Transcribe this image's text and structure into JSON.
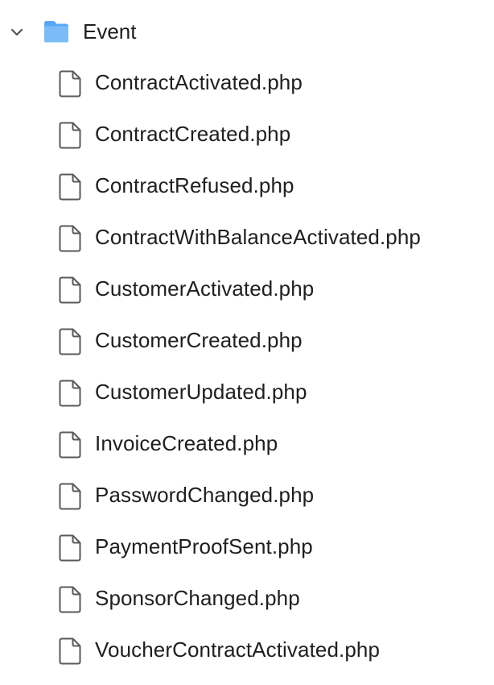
{
  "folder": {
    "name": "Event",
    "expanded": true,
    "icon": "folder-icon",
    "chevron_icon": "chevron-down-icon",
    "folder_color": "#5aa7f5"
  },
  "files": [
    {
      "name": "ContractActivated.php",
      "icon": "file-icon"
    },
    {
      "name": "ContractCreated.php",
      "icon": "file-icon"
    },
    {
      "name": "ContractRefused.php",
      "icon": "file-icon"
    },
    {
      "name": "ContractWithBalanceActivated.php",
      "icon": "file-icon"
    },
    {
      "name": "CustomerActivated.php",
      "icon": "file-icon"
    },
    {
      "name": "CustomerCreated.php",
      "icon": "file-icon"
    },
    {
      "name": "CustomerUpdated.php",
      "icon": "file-icon"
    },
    {
      "name": "InvoiceCreated.php",
      "icon": "file-icon"
    },
    {
      "name": "PasswordChanged.php",
      "icon": "file-icon"
    },
    {
      "name": "PaymentProofSent.php",
      "icon": "file-icon"
    },
    {
      "name": "SponsorChanged.php",
      "icon": "file-icon"
    },
    {
      "name": "VoucherContractActivated.php",
      "icon": "file-icon"
    }
  ]
}
